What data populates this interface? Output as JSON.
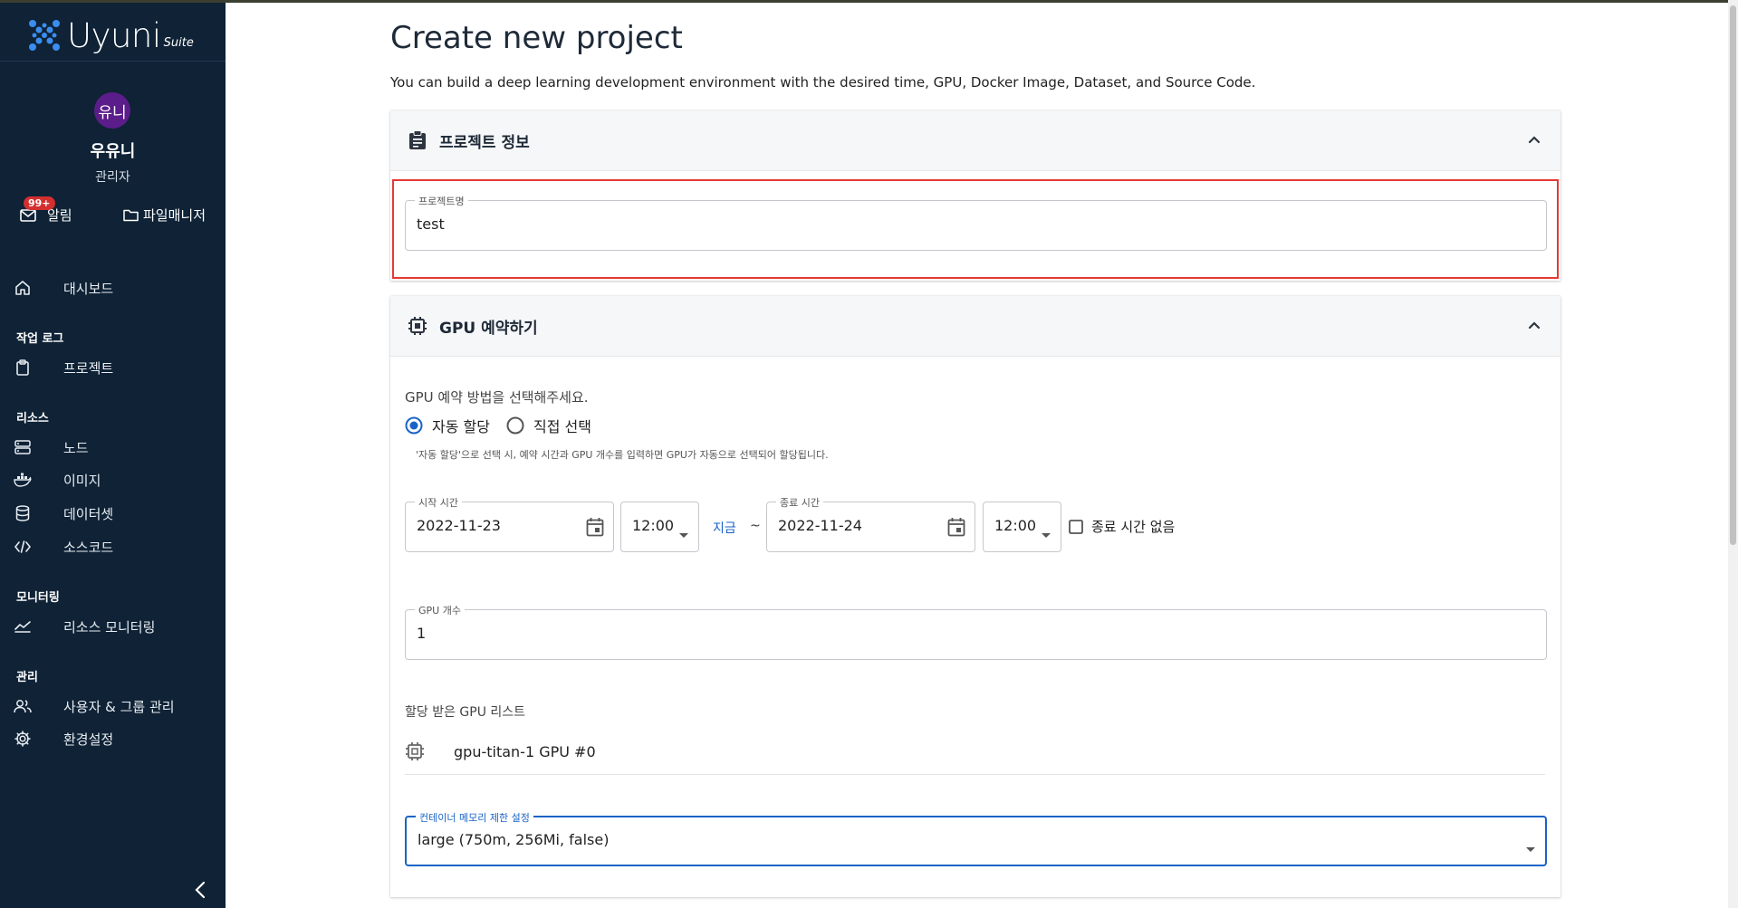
{
  "app": {
    "logo_text": "Uyuni",
    "logo_suite": "Suite"
  },
  "user": {
    "avatar": "유니",
    "name": "우유니",
    "role": "관리자"
  },
  "topbar": {
    "alarm_badge": "99+",
    "alarm_label": "알림",
    "filemanager_label": "파일매니저"
  },
  "nav": {
    "dashboard": "대시보드",
    "section_worklog": "작업 로그",
    "project": "프로젝트",
    "section_resource": "리소스",
    "node": "노드",
    "image": "이미지",
    "dataset": "데이터셋",
    "sourcecode": "소스코드",
    "section_monitoring": "모니터링",
    "resource_monitoring": "리소스 모니터링",
    "section_admin": "관리",
    "user_group": "사용자 & 그룹 관리",
    "settings": "환경설정"
  },
  "page": {
    "title": "Create new project",
    "description": "You can build a deep learning development environment with the desired time, GPU, Docker Image, Dataset, and Source Code."
  },
  "project_info": {
    "header": "프로젝트 정보",
    "name_label": "프로젝트명",
    "name_value": "test"
  },
  "gpu": {
    "header": "GPU 예약하기",
    "method_prompt": "GPU 예약 방법을 선택해주세요.",
    "option_auto": "자동 할당",
    "option_manual": "직접 선택",
    "selected_option": "auto",
    "auto_hint": "'자동 할당'으로 선택 시, 예약 시간과 GPU 개수를 입력하면 GPU가 자동으로 선택되어 할당됩니다.",
    "start_label": "시작 시간",
    "start_date": "2022-11-23",
    "start_time": "12:00",
    "now_link": "지금",
    "tilde": "~",
    "end_label": "종료 시간",
    "end_date": "2022-11-24",
    "end_time": "12:00",
    "no_end_label": "종료 시간 없음",
    "count_label": "GPU 개수",
    "count_value": "1",
    "assigned_title": "할당 받은 GPU 리스트",
    "assigned_item": "gpu-titan-1 GPU #0",
    "memory_label": "컨테이너 메모리 제한 설정",
    "memory_value": "large (750m, 256Mi, false)"
  },
  "colors": {
    "sidebar_bg": "#0f2236",
    "accent_blue": "#1a63c6",
    "badge_red": "#d32f2f",
    "highlight_red": "#e53935",
    "avatar_purple": "#5b1d8a"
  }
}
